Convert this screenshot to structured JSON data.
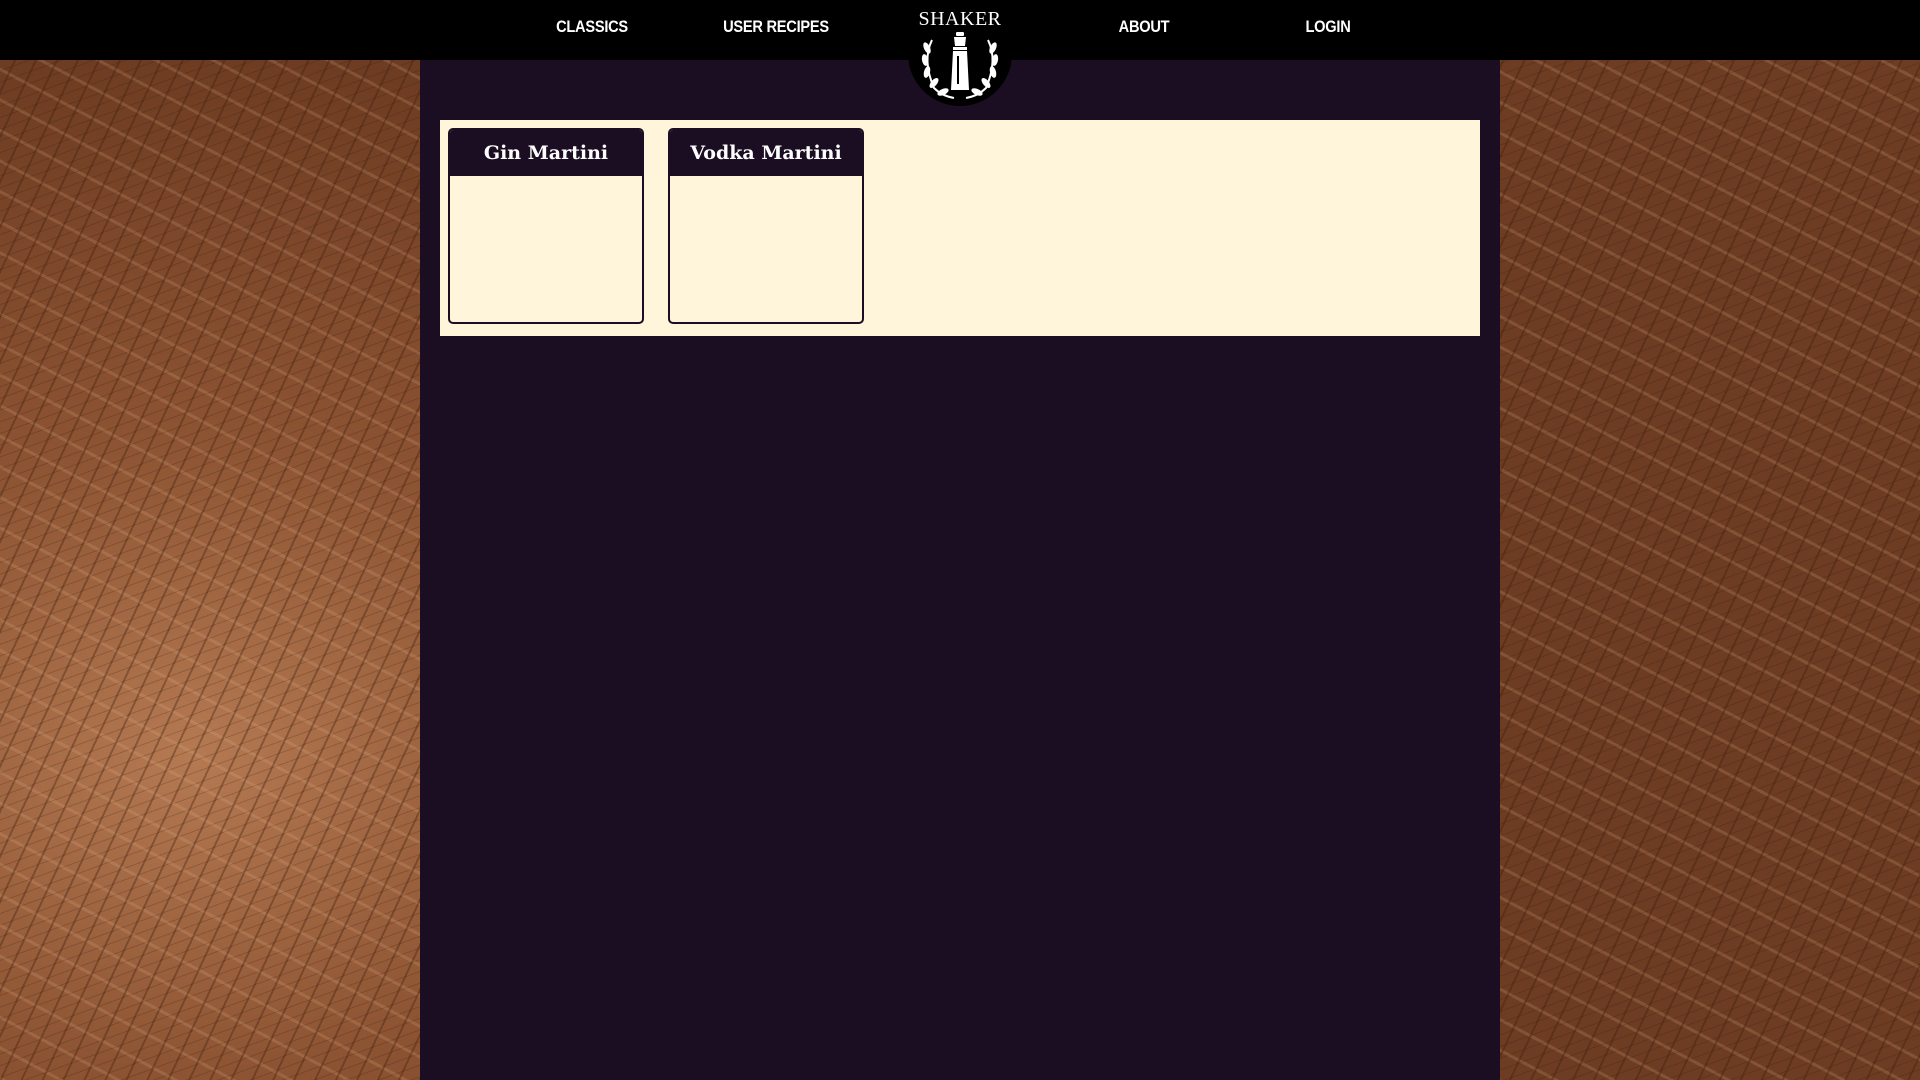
{
  "nav": {
    "links": [
      {
        "label": "CLASSICS"
      },
      {
        "label": "USER RECIPES"
      },
      {
        "label": "ABOUT"
      },
      {
        "label": "LOGIN"
      }
    ],
    "logo": {
      "text": "SHAKER",
      "icon": "cocktail-shaker-laurel-icon"
    }
  },
  "cards": [
    {
      "title": "Gin Martini"
    },
    {
      "title": "Vodka Martini"
    }
  ],
  "colors": {
    "nav_background": "#000000",
    "main_background": "#1c0e22",
    "panel_background": "#fff5da",
    "card_header": "#1c0e22",
    "nav_text": "#ffffff"
  },
  "background": "wood-texture"
}
